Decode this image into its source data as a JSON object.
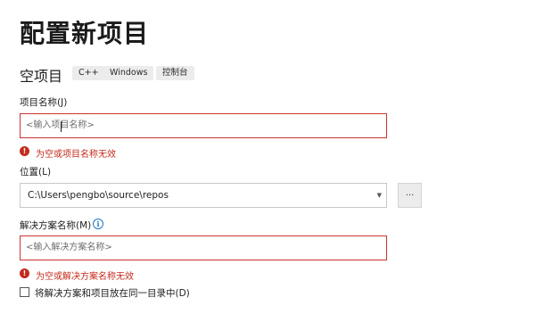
{
  "page": {
    "title": "配置新项目"
  },
  "template": {
    "name": "空项目",
    "tags": [
      "C++",
      "Windows",
      "控制台"
    ]
  },
  "project_name": {
    "label": "项目名称(J)",
    "placeholder": "<输入项目名称>",
    "error": "为空或项目名称无效"
  },
  "location": {
    "label": "位置(L)",
    "value": "C:\\Users\\pengbo\\source\\repos",
    "browse_label": "..."
  },
  "solution_name": {
    "label": "解决方案名称(M)",
    "info": "i",
    "placeholder": "<输入解决方案名称>",
    "error": "为空或解决方案名称无效"
  },
  "same_dir": {
    "label": "将解决方案和项目放在同一目录中(D)",
    "checked": false
  },
  "colors": {
    "error": "#c42b1c",
    "info": "#1a73c7",
    "error_border": "#cc3333"
  }
}
